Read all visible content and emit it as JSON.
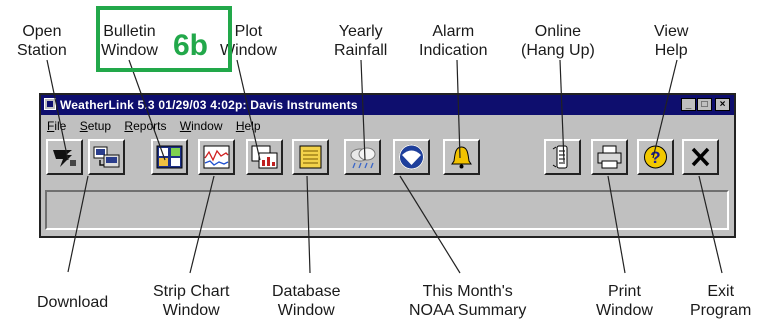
{
  "window": {
    "title": "WeatherLink 5.3  01/29/03   4:02p: Davis Instruments",
    "controls": {
      "minimize": "_",
      "maximize": "□",
      "close": "×"
    }
  },
  "menu": [
    "File",
    "Setup",
    "Reports",
    "Window",
    "Help"
  ],
  "toolbar_buttons": [
    {
      "icon": "open-station-icon"
    },
    {
      "icon": "download-icon"
    },
    {
      "icon": "bulletin-window-icon"
    },
    {
      "icon": "strip-chart-icon"
    },
    {
      "icon": "plot-window-icon"
    },
    {
      "icon": "database-window-icon"
    },
    {
      "icon": "yearly-rainfall-icon"
    },
    {
      "icon": "noaa-summary-icon"
    },
    {
      "icon": "alarm-bell-icon"
    },
    {
      "icon": "online-hang-up-icon"
    },
    {
      "icon": "print-window-icon"
    },
    {
      "icon": "view-help-icon"
    },
    {
      "icon": "exit-program-icon"
    }
  ],
  "highlight": {
    "tag": "6b",
    "color": "#22a84a"
  },
  "callouts_top": {
    "open_station": [
      "Open",
      "Station"
    ],
    "bulletin_window": [
      "Bulletin",
      "Window"
    ],
    "plot_window": [
      "Plot",
      "Window"
    ],
    "yearly_rainfall": [
      "Yearly",
      "Rainfall"
    ],
    "alarm_indication": [
      "Alarm",
      "Indication"
    ],
    "online_hang_up": [
      "Online",
      "(Hang Up)"
    ],
    "view_help": [
      "View",
      "Help"
    ]
  },
  "callouts_bottom": {
    "download": [
      "Download"
    ],
    "strip_chart_window": [
      "Strip Chart",
      "Window"
    ],
    "database_window": [
      "Database",
      "Window"
    ],
    "noaa_summary": [
      "This Month's",
      "NOAA Summary"
    ],
    "print_window": [
      "Print",
      "Window"
    ],
    "exit_program": [
      "Exit",
      "Program"
    ]
  },
  "colors": {
    "titlebar": "#0e0e6e",
    "window_face": "#c0c0c0",
    "highlight": "#22a84a"
  }
}
